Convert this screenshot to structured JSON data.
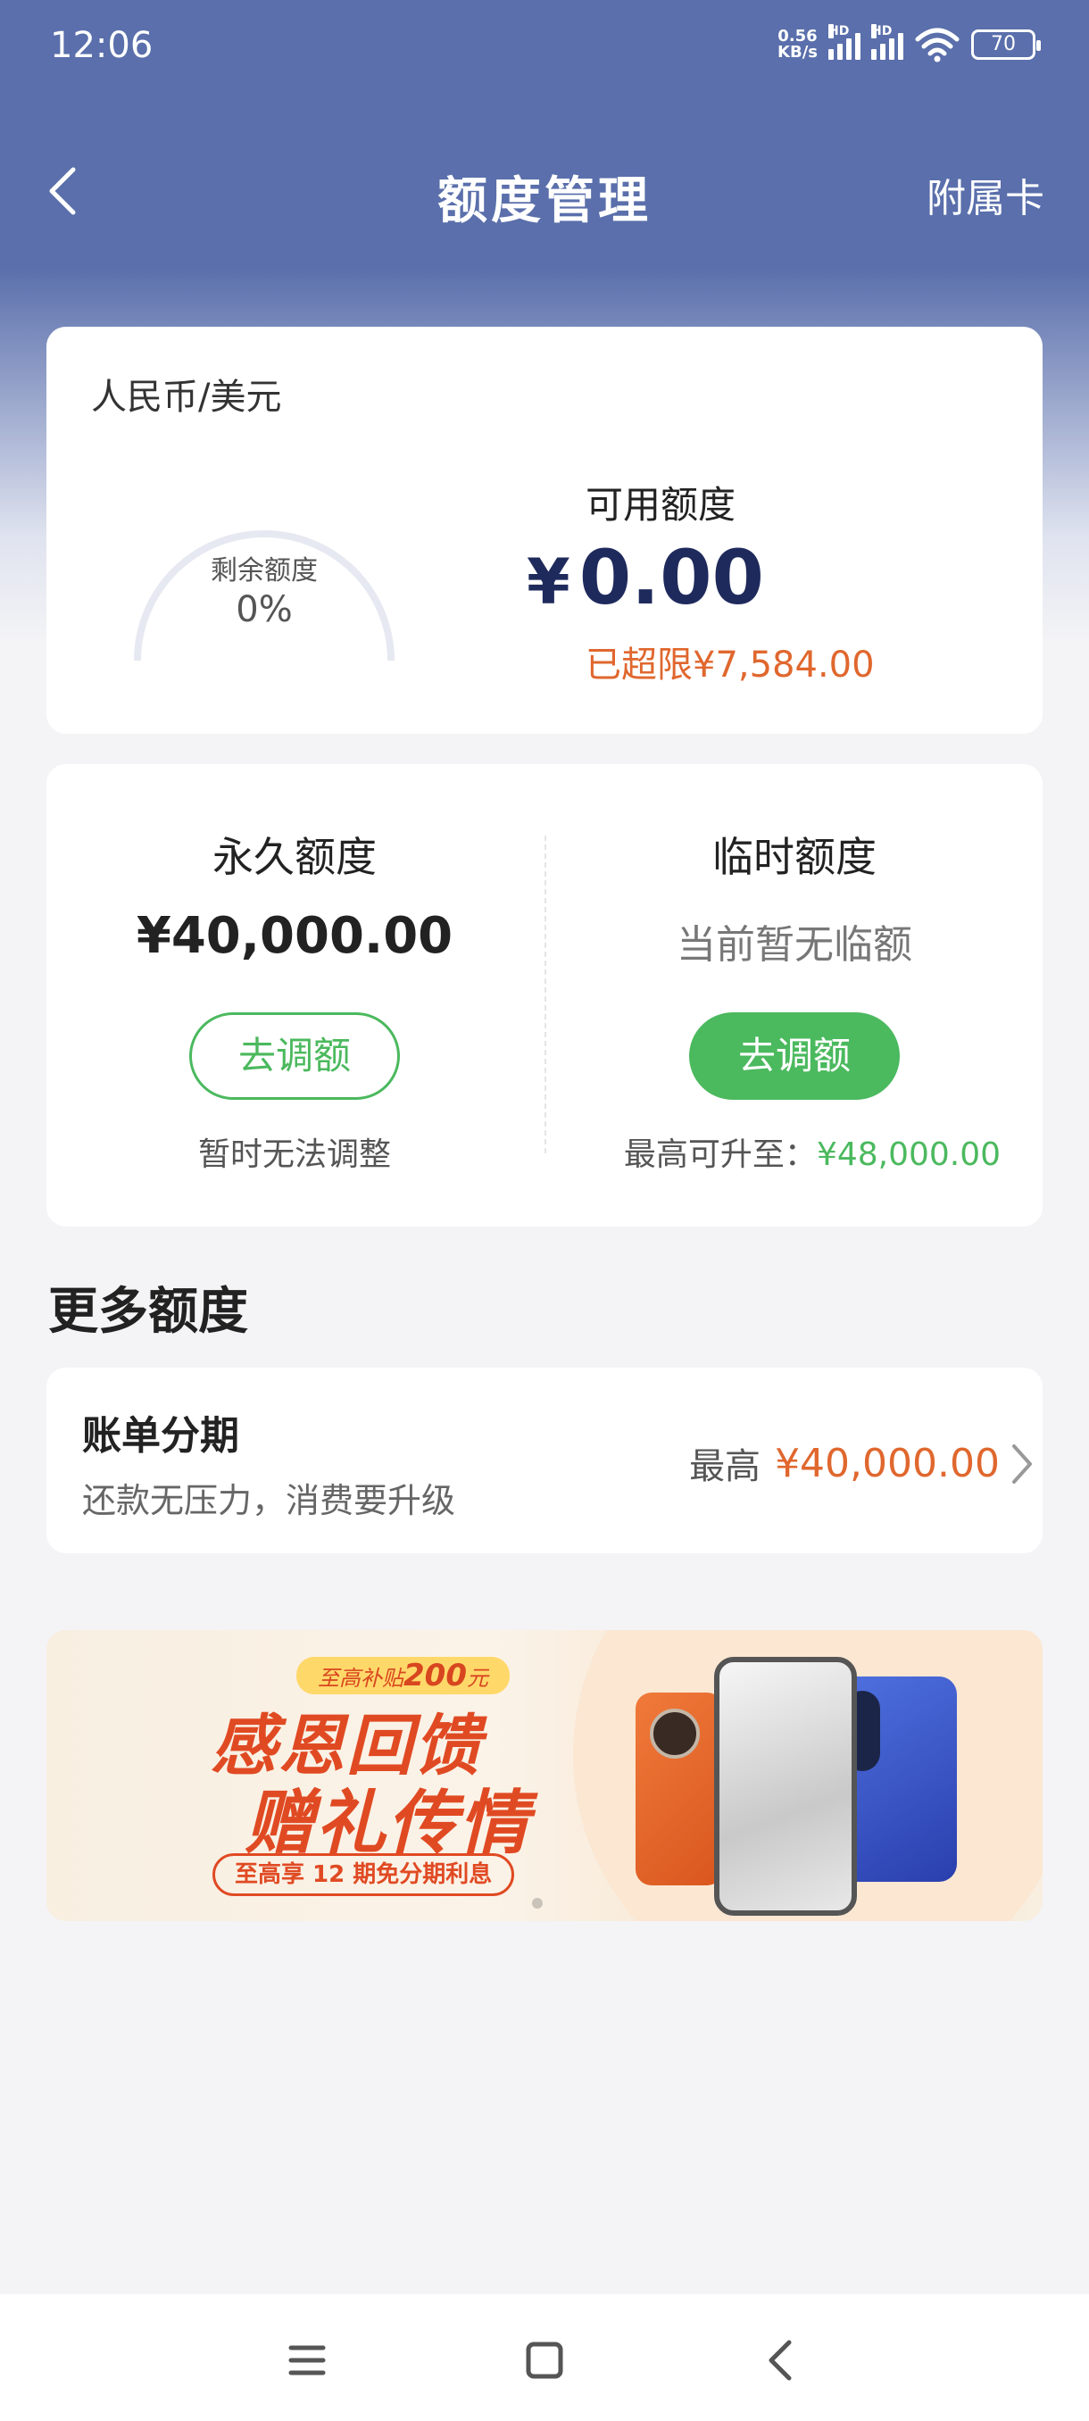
{
  "status_bar": {
    "time": "12:06",
    "net_speed_value": "0.56",
    "net_speed_unit": "KB/s",
    "signal_label_1": "HD",
    "signal_label_2": "HD",
    "battery": "70"
  },
  "nav": {
    "title": "额度管理",
    "right_label": "附属卡"
  },
  "summary": {
    "currency": "人民币/美元",
    "remaining_label": "剩余额度",
    "remaining_percent": "0%",
    "remaining_fraction": 0,
    "available_label": "可用额度",
    "available_currency": "¥",
    "available_amount": "0.00",
    "overlimit": "已超限¥7,584.00"
  },
  "limits": {
    "permanent": {
      "title": "永久额度",
      "amount": "¥40,000.00",
      "button": "去调额",
      "note": "暂时无法调整"
    },
    "temporary": {
      "title": "临时额度",
      "status": "当前暂无临额",
      "button": "去调额",
      "note_prefix": "最高可升至：",
      "note_amount": "¥48,000.00"
    }
  },
  "more": {
    "section_title": "更多额度",
    "installment": {
      "title": "账单分期",
      "subtitle": "还款无压力，消费要升级",
      "max_label": "最高",
      "max_amount": "¥40,000.00"
    }
  },
  "banner": {
    "pill_prefix": "至高补贴",
    "pill_amount": "200",
    "pill_suffix": "元",
    "line1": "感恩回馈",
    "line2": "赠礼传情",
    "tag": "至高享 12 期免分期利息"
  },
  "colors": {
    "header_blue": "#5a6fab",
    "accent_green": "#4bb95e",
    "accent_orange": "#e0672e",
    "amount_navy": "#1f2a5c"
  },
  "icons": {
    "back": "chevron-left-icon",
    "chevron": "chevron-right-icon",
    "menu": "menu-icon",
    "home": "home-icon",
    "nav_back": "back-icon"
  }
}
